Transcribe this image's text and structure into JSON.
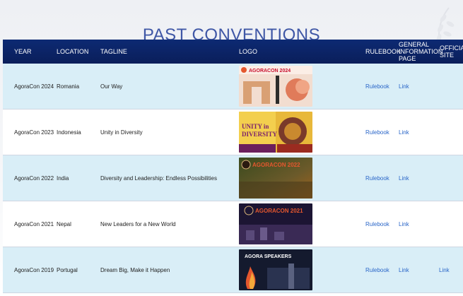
{
  "page": {
    "title": "PAST CONVENTIONS"
  },
  "table": {
    "headers": {
      "year": "YEAR",
      "location": "LOCATION",
      "tagline": "TAGLINE",
      "logo": "LOGO",
      "rulebook": "RULEBOOK",
      "general_info": "GENERAL INFORMATION PAGE",
      "official_site": "OFFICIAL SITE"
    },
    "rows": [
      {
        "year": "AgoraCon 2024",
        "location": "Romania",
        "tagline": "Our Way",
        "rulebook": "Rulebook",
        "info": "Link",
        "site": "",
        "logo_text": "AGORACON 2024"
      },
      {
        "year": "AgoraCon 2023",
        "location": "Indonesia",
        "tagline": "Unity in Diversity",
        "rulebook": "Rulebook",
        "info": "Link",
        "site": "",
        "logo_text": "UNITY in DIVERSITY"
      },
      {
        "year": "AgoraCon 2022",
        "location": "India",
        "tagline": "Diversity and Leadership: Endless Possibilities",
        "rulebook": "Rulebook",
        "info": "Link",
        "site": "",
        "logo_text": "AGORACON 2022"
      },
      {
        "year": "AgoraCon 2021",
        "location": "Nepal",
        "tagline": "New Leaders for a New World",
        "rulebook": "Rulebook",
        "info": "Link",
        "site": "",
        "logo_text": "AGORACON 2021"
      },
      {
        "year": "AgoraCon 2019",
        "location": "Portugal",
        "tagline": "Dream Big, Make it Happen",
        "rulebook": "Rulebook",
        "info": "Link",
        "site": "Link",
        "logo_text": "AGORA SPEAKERS"
      }
    ]
  },
  "colors": {
    "header_bg": "#0d2a73",
    "title": "#3f57a6",
    "row_alt": "#d9eef7",
    "link": "#2a66c8"
  }
}
